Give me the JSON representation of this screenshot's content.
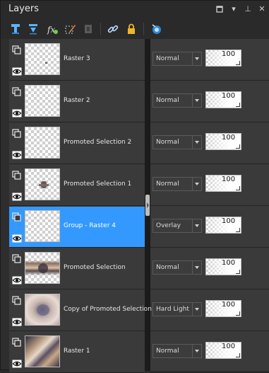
{
  "panel": {
    "title": "Layers"
  },
  "window_controls": [
    "restore-icon",
    "menu-dropdown-icon",
    "pin-icon",
    "close-icon"
  ],
  "window_controls_glyphs": {
    "menu": "▾",
    "pin": "⊥",
    "close": "✕"
  },
  "toolbar": {
    "tools": [
      "new-raster-layer-icon",
      "new-vector-layer-icon",
      "layer-properties-icon",
      "edit-selection-icon",
      "disabled-layer-icon",
      "link-layers-icon",
      "lock-icon",
      "mask-icon"
    ]
  },
  "colors": {
    "accent_selected": "#3399ff",
    "panel_bg": "#3a3a3a",
    "divider": "#1b1b1b"
  },
  "layers": [
    {
      "name": "Raster 3",
      "blend_mode": "Normal",
      "opacity": "100",
      "selected": false,
      "thumb": "transparent-dot"
    },
    {
      "name": "Raster 2",
      "blend_mode": "Normal",
      "opacity": "100",
      "selected": false,
      "thumb": "transparent"
    },
    {
      "name": "Promoted Selection 2",
      "blend_mode": "Normal",
      "opacity": "100",
      "selected": false,
      "thumb": "transparent"
    },
    {
      "name": "Promoted Selection 1",
      "blend_mode": "Normal",
      "opacity": "100",
      "selected": false,
      "thumb": "small-figure"
    },
    {
      "name": "Group - Raster 4",
      "blend_mode": "Overlay",
      "opacity": "100",
      "selected": true,
      "thumb": "transparent"
    },
    {
      "name": "Promoted Selection",
      "blend_mode": "Normal",
      "opacity": "100",
      "selected": false,
      "thumb": "band"
    },
    {
      "name": "Copy of Promoted Selection",
      "blend_mode": "Hard Light",
      "opacity": "100",
      "selected": false,
      "thumb": "blur"
    },
    {
      "name": "Raster 1",
      "blend_mode": "Normal",
      "opacity": "100",
      "selected": false,
      "thumb": "photo"
    }
  ]
}
